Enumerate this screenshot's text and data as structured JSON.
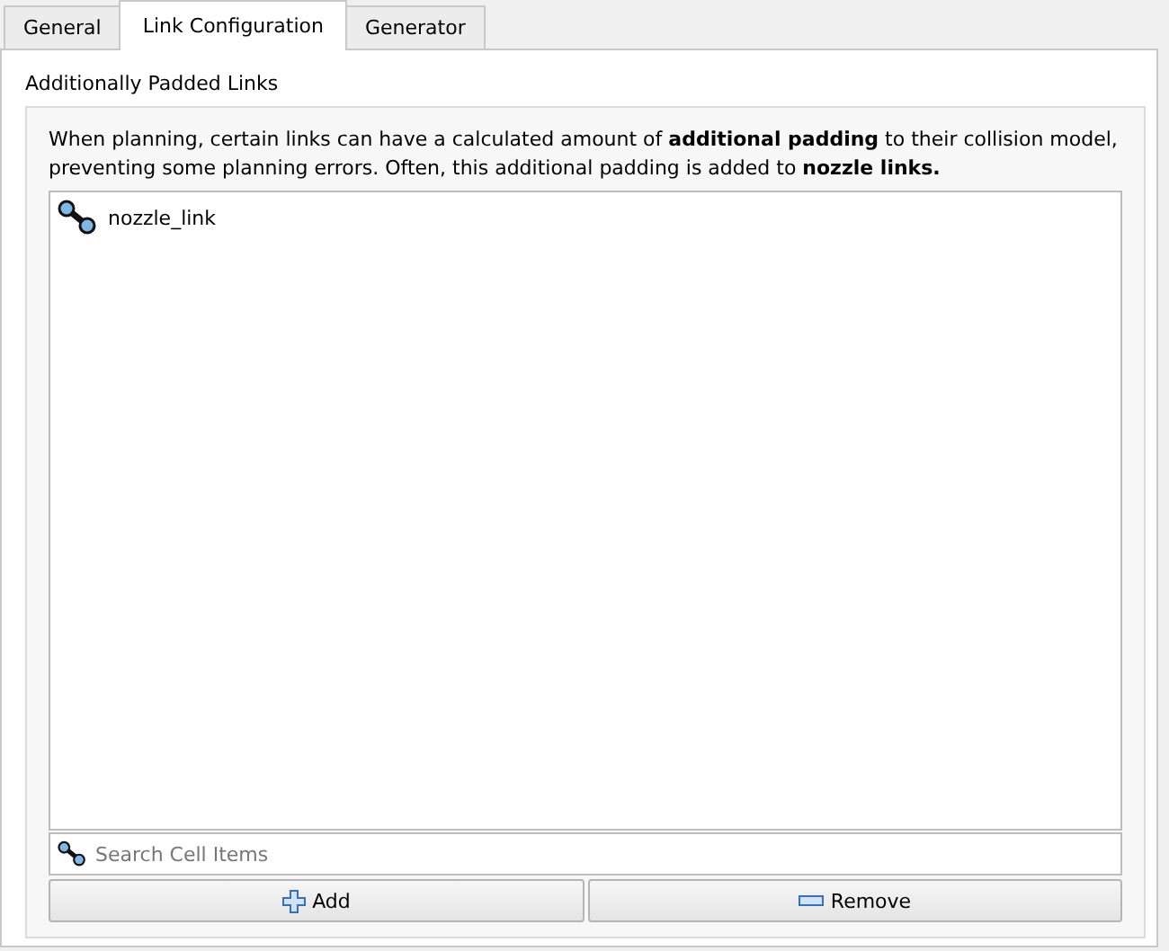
{
  "tabs": [
    {
      "label": "General",
      "selected": false
    },
    {
      "label": "Link Configuration",
      "selected": true
    },
    {
      "label": "Generator",
      "selected": false
    }
  ],
  "group": {
    "title": "Additionally Padded Links",
    "description": "When planning, certain links can have a calculated amount of **additional padding** to their collision model, preventing some planning errors. Often, this additional padding is added to **nozzle links.**",
    "items": [
      {
        "label": "nozzle_link",
        "selected": false
      }
    ],
    "search": {
      "placeholder": "Search Cell Items"
    },
    "buttons": [
      {
        "label": "Add",
        "kind": "add"
      },
      {
        "label": "Remove",
        "kind": "remove"
      }
    ]
  }
}
